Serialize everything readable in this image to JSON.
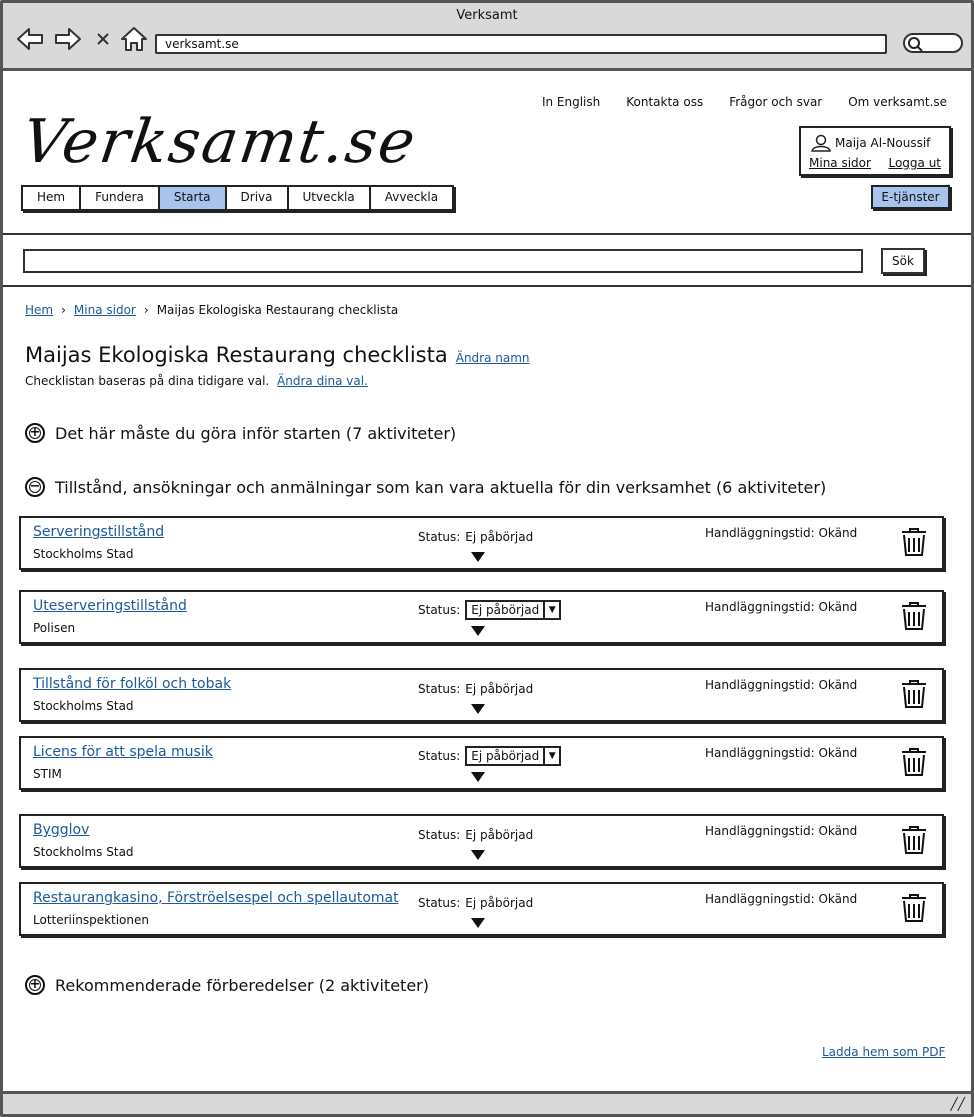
{
  "browser": {
    "window_title": "Verksamt",
    "address": "verksamt.se",
    "icons": [
      "back-arrow-icon",
      "forward-arrow-icon",
      "close-icon",
      "home-icon",
      "search-icon"
    ]
  },
  "header": {
    "logo": "Verksamt.se",
    "top_links": [
      "In English",
      "Kontakta oss",
      "Frågor och svar",
      "Om verksamt.se"
    ],
    "user": {
      "name": "Maija Al-Noussif",
      "my_pages": "Mina sidor",
      "logout": "Logga ut"
    },
    "nav_tabs": [
      {
        "label": "Hem",
        "active": false
      },
      {
        "label": "Fundera",
        "active": false
      },
      {
        "label": "Starta",
        "active": true
      },
      {
        "label": "Driva",
        "active": false
      },
      {
        "label": "Utveckla",
        "active": false
      },
      {
        "label": "Avveckla",
        "active": false
      }
    ],
    "eservices_button": "E-tjänster",
    "accent_color": "#a8c4ec"
  },
  "search": {
    "value": "",
    "button": "Sök"
  },
  "breadcrumb": [
    "Hem",
    "Mina sidor",
    "Maijas Ekologiska Restaurang checklista"
  ],
  "page": {
    "title": "Maijas Ekologiska Restaurang checklista",
    "rename_link": "Ändra namn",
    "subtitle": "Checklistan baseras på dina tidigare val.",
    "change_choices_link": "Ändra dina val."
  },
  "sections": [
    {
      "label": "Det här måste du göra inför starten (7 aktiviteter)",
      "expanded": false
    },
    {
      "label": "Tillstånd, ansökningar och anmälningar som kan vara aktuella för din verksamhet (6 aktiviteter)",
      "expanded": true
    },
    {
      "label": "Rekommenderade förberedelser (2 aktiviteter)",
      "expanded": false
    }
  ],
  "activities": [
    {
      "title": "Serveringstillstånd",
      "org": "Stockholms Stad",
      "status_label": "Status:",
      "status": "Ej påbörjad",
      "status_is_dropdown": false,
      "time_label": "Handläggningstid:",
      "time": "Okänd"
    },
    {
      "title": "Uteserveringstillstånd",
      "org": "Polisen",
      "status_label": "Status:",
      "status": "Ej påbörjad",
      "status_is_dropdown": true,
      "time_label": "Handläggningstid:",
      "time": "Okänd"
    },
    {
      "title": "Tillstånd för folköl och tobak",
      "org": "Stockholms Stad",
      "status_label": "Status:",
      "status": "Ej påbörjad",
      "status_is_dropdown": false,
      "time_label": "Handläggningstid:",
      "time": "Okänd"
    },
    {
      "title": "Licens för att spela musik",
      "org": "STIM",
      "status_label": "Status:",
      "status": "Ej påbörjad",
      "status_is_dropdown": true,
      "time_label": "Handläggningstid:",
      "time": "Okänd"
    },
    {
      "title": "Bygglov",
      "org": "Stockholms Stad",
      "status_label": "Status:",
      "status": "Ej påbörjad",
      "status_is_dropdown": false,
      "time_label": "Handläggningstid:",
      "time": "Okänd"
    },
    {
      "title": "Restaurangkasino, Förströelsespel och spellautomat",
      "org": "Lotteriinspektionen",
      "status_label": "Status:",
      "status": "Ej påbörjad",
      "status_is_dropdown": false,
      "time_label": "Handläggningstid:",
      "time": "Okänd"
    }
  ],
  "footer": {
    "pdf_link": "Ladda hem som PDF"
  }
}
